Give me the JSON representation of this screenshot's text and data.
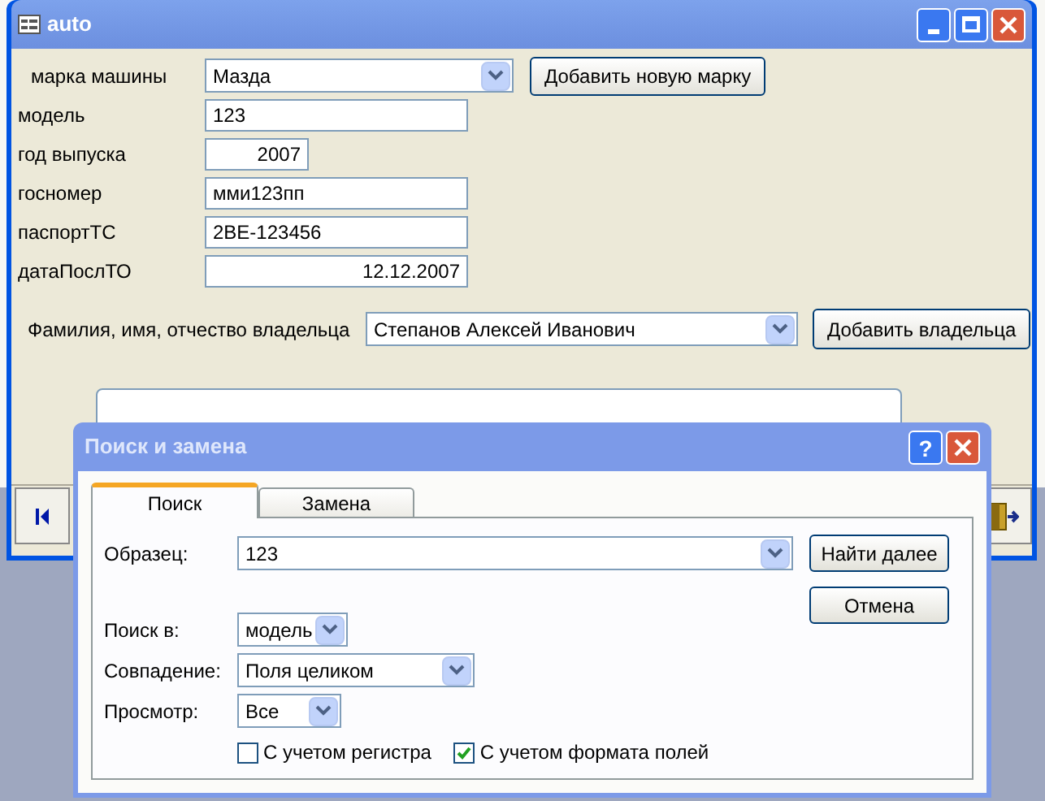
{
  "window": {
    "title": "auto"
  },
  "form": {
    "fields": [
      {
        "label": "марка машины",
        "value": "Мазда",
        "kind": "combo"
      },
      {
        "label": "модель",
        "value": "123",
        "kind": "text"
      },
      {
        "label": "год выпуска",
        "value": "2007",
        "kind": "number"
      },
      {
        "label": "госномер",
        "value": "мми123пп",
        "kind": "text"
      },
      {
        "label": "паспортТС",
        "value": "2ВЕ-123456",
        "kind": "text"
      },
      {
        "label": "датаПослТО",
        "value": "12.12.2007",
        "kind": "number"
      }
    ],
    "add_brand_button": "Добавить новую марку",
    "owner": {
      "label": "Фамилия, имя, отчество владельца",
      "value": "Степанов Алексей Иванович"
    },
    "add_owner_button": "Добавить владельца"
  },
  "dialog": {
    "title": "Поиск и замена",
    "help_button": "?",
    "tabs": [
      {
        "label": "Поиск",
        "selected": true
      },
      {
        "label": "Замена",
        "selected": false
      }
    ],
    "pattern": {
      "label": "Образец:",
      "value": "123"
    },
    "find_next_button": "Найти далее",
    "cancel_button": "Отмена",
    "search_in": {
      "label": "Поиск в:",
      "value": "модель"
    },
    "match": {
      "label": "Совпадение:",
      "value": "Поля целиком"
    },
    "view": {
      "label": "Просмотр:",
      "value": "Все"
    },
    "checkboxes": [
      {
        "label": "С учетом регистра",
        "checked": false
      },
      {
        "label": "С учетом формата полей",
        "checked": true
      }
    ]
  }
}
